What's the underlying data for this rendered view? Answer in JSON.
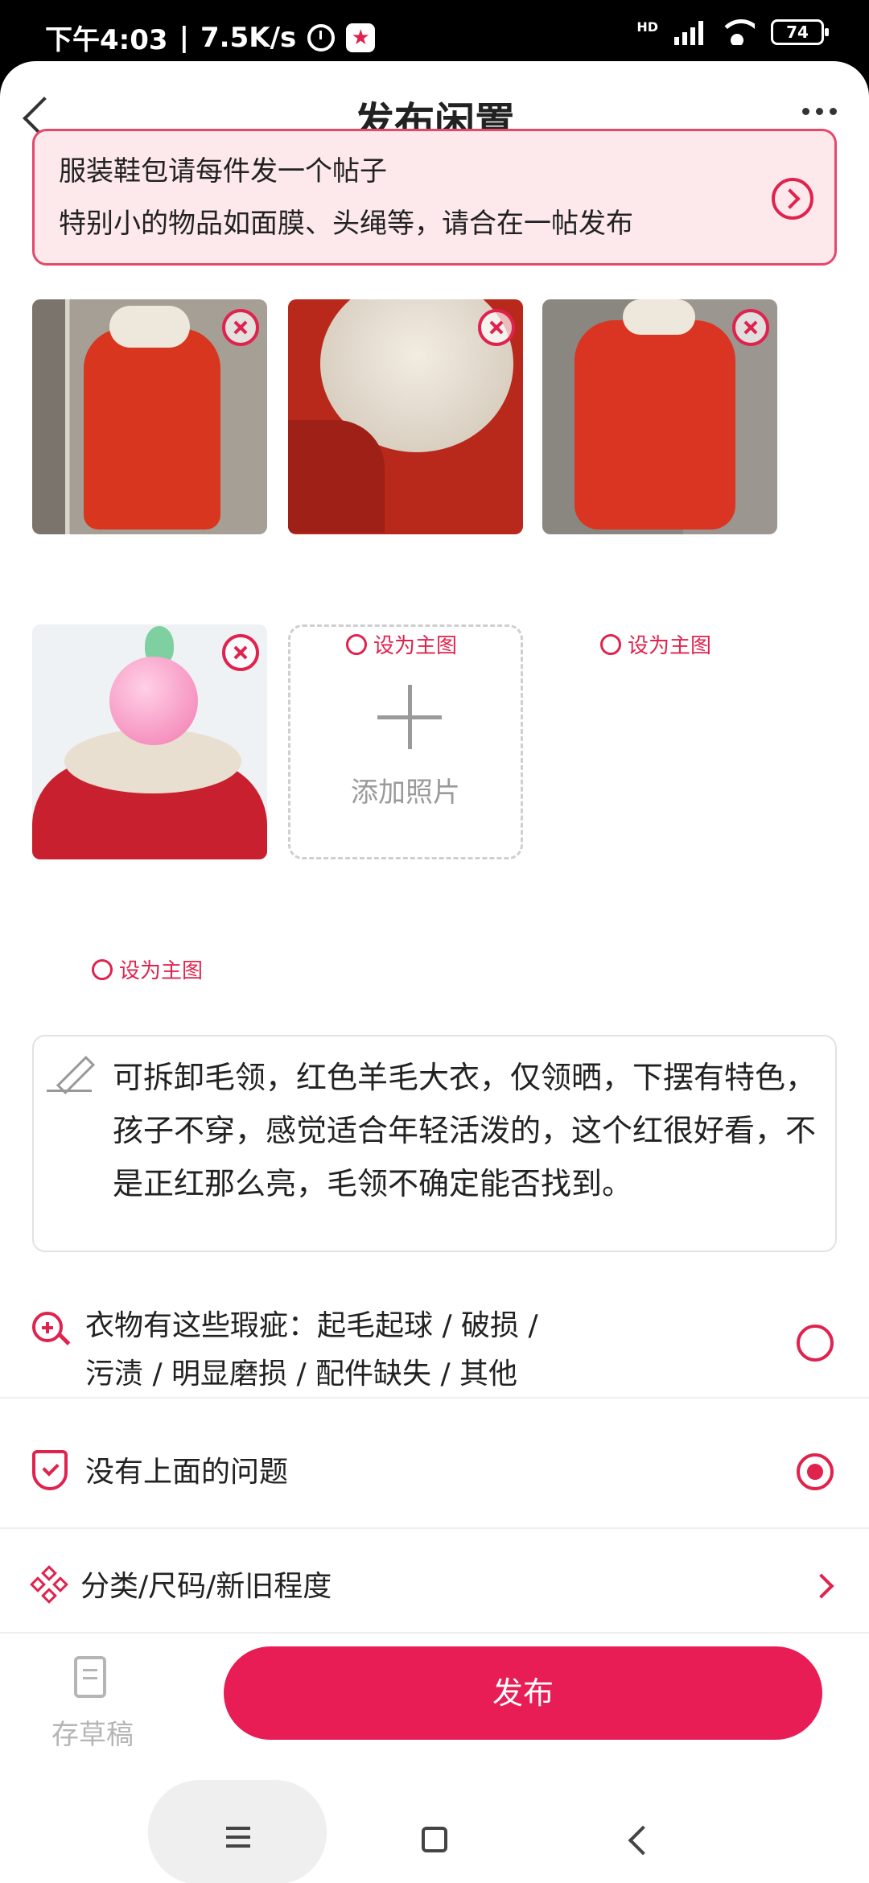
{
  "status_bar": {
    "time": "下午4:03",
    "speed": "7.5K/s",
    "network": "HD",
    "battery": "74"
  },
  "header": {
    "title": "发布闲置"
  },
  "notice": {
    "line1": "服装鞋包请每件发一个帖子",
    "line2": "特别小的物品如面膜、头绳等，请合在一帖发布"
  },
  "photos": {
    "set_main_label": "设为主图",
    "selected_main_index": 0,
    "items": [
      {
        "index": 1
      },
      {
        "index": 2
      },
      {
        "index": 3
      },
      {
        "index": 4
      }
    ]
  },
  "add_photo": {
    "label": "添加照片"
  },
  "description": {
    "text": "可拆卸毛领，红色羊毛大衣，仅领晒，下摆有特色，孩子不穿，感觉适合年轻活泼的，这个红很好看，不是正红那么亮，毛领不确定能否找到。"
  },
  "condition": {
    "flaws_line1": "衣物有这些瑕疵：起毛起球 / 破损 /",
    "flaws_line2": "污渍 / 明显磨损 / 配件缺失 / 其他",
    "no_issue": "没有上面的问题",
    "selected": "no_issue"
  },
  "category_row": {
    "label": "分类/尺码/新旧程度"
  },
  "bottom_bar": {
    "draft_label": "存草稿",
    "publish_label": "发布"
  },
  "colors": {
    "accent": "#e0234e",
    "publish_button": "#e81d56",
    "notice_bg": "#fde9ec"
  }
}
